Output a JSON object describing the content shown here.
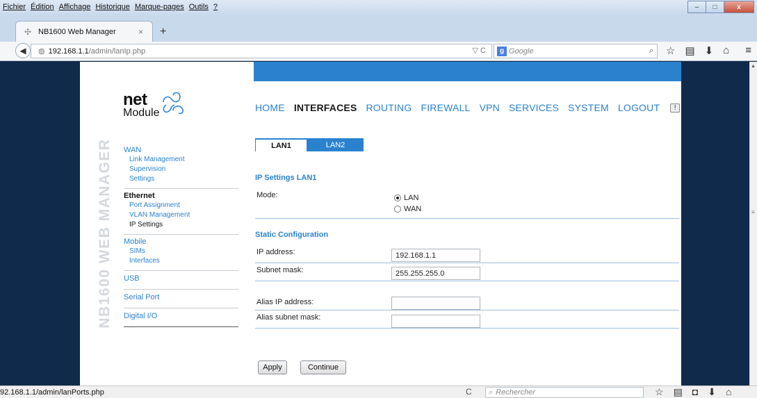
{
  "browser": {
    "menus": [
      "Fichier",
      "Édition",
      "Affichage",
      "Historique",
      "Marque-pages",
      "Outils",
      "?"
    ],
    "window_buttons": [
      "–",
      "□",
      "x"
    ],
    "tab_title": "NB1600 Web Manager",
    "tab_close": "×",
    "new_tab": "+",
    "url_host": "192.168.1.1",
    "url_path": "/admin/lanIp.php",
    "url_icons": "▽ C",
    "search_engine_icon": "g",
    "search_placeholder": "Google",
    "status_url": "92.168.1.1/admin/lanPorts.php",
    "bottom_search_placeholder": "Rechercher"
  },
  "site": {
    "logo_net": "net",
    "logo_module": "Module",
    "vertical_title": "NB1600 WEB MANAGER",
    "topnav": [
      {
        "label": "HOME",
        "active": false
      },
      {
        "label": "INTERFACES",
        "active": true
      },
      {
        "label": "ROUTING",
        "active": false
      },
      {
        "label": "FIREWALL",
        "active": false
      },
      {
        "label": "VPN",
        "active": false
      },
      {
        "label": "SERVICES",
        "active": false
      },
      {
        "label": "SYSTEM",
        "active": false
      },
      {
        "label": "LOGOUT",
        "active": false
      }
    ],
    "alert_icon": "!"
  },
  "sidebar": {
    "wan": {
      "head": "WAN",
      "items": [
        "Link Management",
        "Supervision",
        "Settings"
      ]
    },
    "ethernet": {
      "head": "Ethernet",
      "items": [
        "Port Assignment",
        "VLAN Management",
        "IP Settings"
      ]
    },
    "mobile": {
      "head": "Mobile",
      "items": [
        "SIMs",
        "Interfaces"
      ]
    },
    "usb": {
      "head": "USB"
    },
    "serial": {
      "head": "Serial Port"
    },
    "digital": {
      "head": "Digital I/O"
    }
  },
  "main": {
    "tabs": [
      "LAN1",
      "LAN2"
    ],
    "section_ip": "IP Settings LAN1",
    "mode_label": "Mode:",
    "mode_options": [
      "LAN",
      "WAN"
    ],
    "mode_selected": "LAN",
    "section_static": "Static Configuration",
    "fields": {
      "ip_label": "IP address:",
      "ip_value": "192.168.1.1",
      "mask_label": "Subnet mask:",
      "mask_value": "255.255.255.0",
      "alias_ip_label": "Alias IP address:",
      "alias_ip_value": "",
      "alias_mask_label": "Alias subnet mask:",
      "alias_mask_value": ""
    },
    "apply_label": "Apply",
    "continue_label": "Continue"
  },
  "colors": {
    "accent": "#2a82cf",
    "page_background": "#0f2a4a"
  }
}
